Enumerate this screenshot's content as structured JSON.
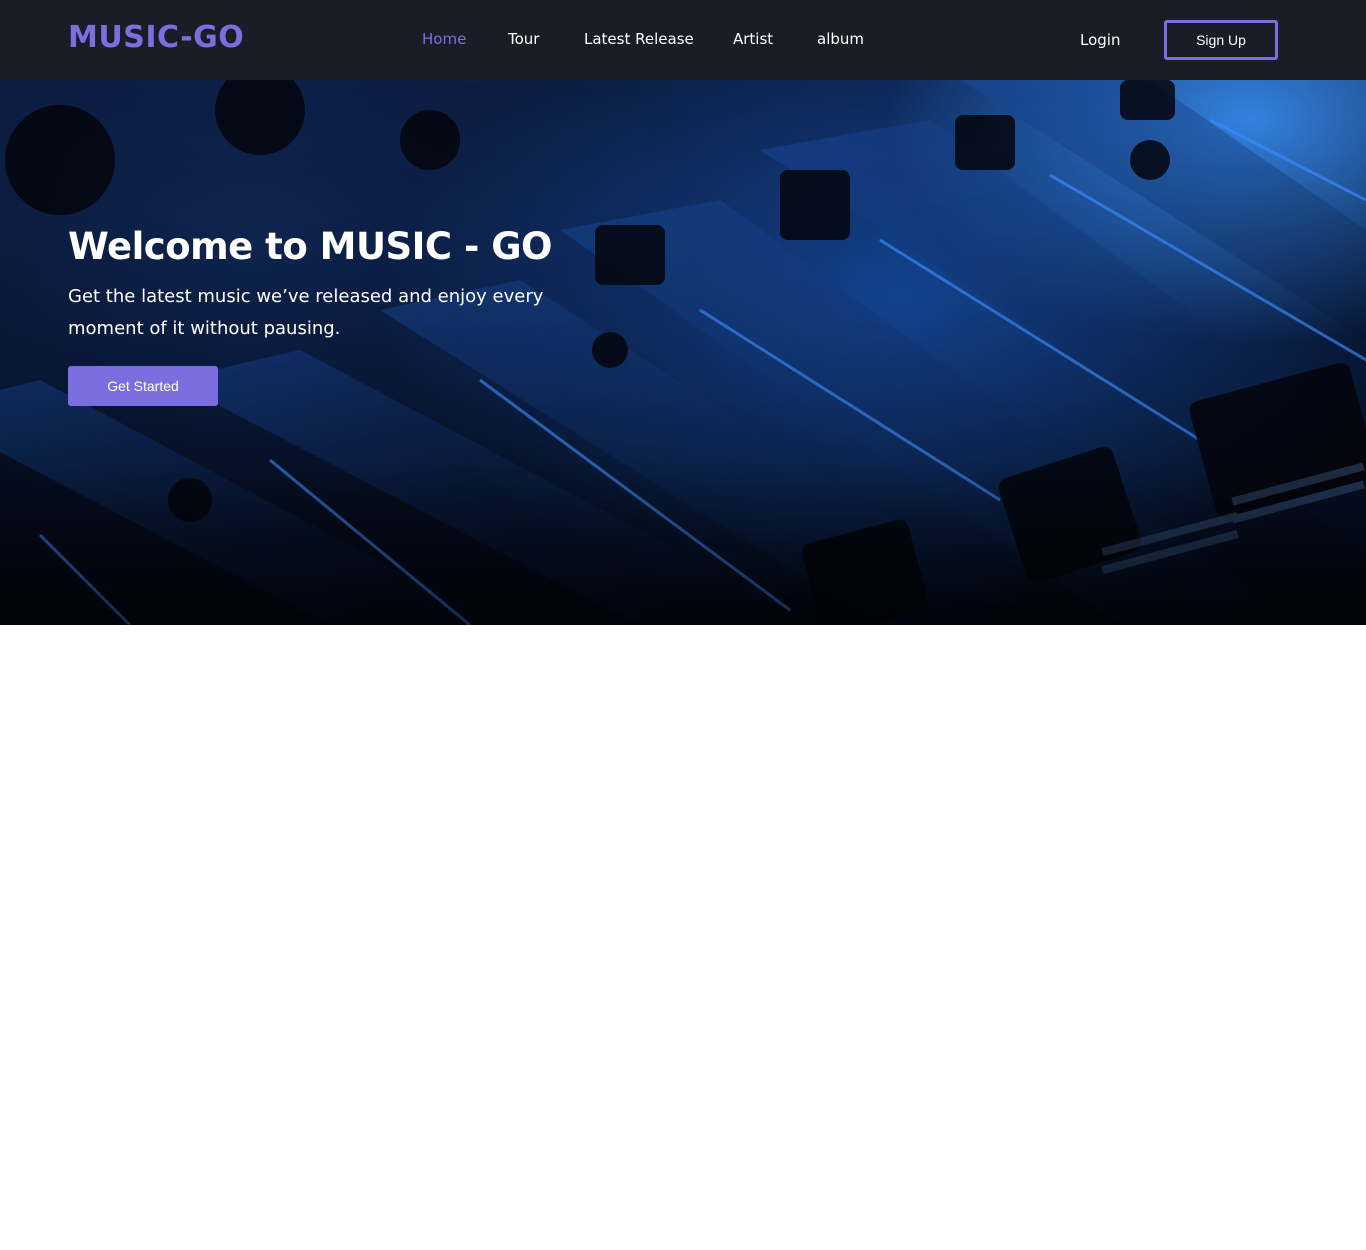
{
  "navbar": {
    "brand": "MUSIC-GO",
    "links": [
      {
        "label": "Home",
        "active": true
      },
      {
        "label": "Tour",
        "active": false
      },
      {
        "label": "Latest Release",
        "active": false
      },
      {
        "label": "Artist",
        "active": false
      },
      {
        "label": "album",
        "active": false
      }
    ],
    "login_label": "Login",
    "signup_label": "Sign Up"
  },
  "hero": {
    "title": "Welcome to MUSIC - GO",
    "subtitle": "Get the latest music we’ve released and enjoy every moment of it without pausing.",
    "cta_label": "Get Started",
    "background_image": "audio-mixing-console-faders"
  },
  "colors": {
    "accent": "#7b6fe0",
    "navbar_bg": "#1a1c26",
    "hero_tint": "#1a5fd0"
  }
}
